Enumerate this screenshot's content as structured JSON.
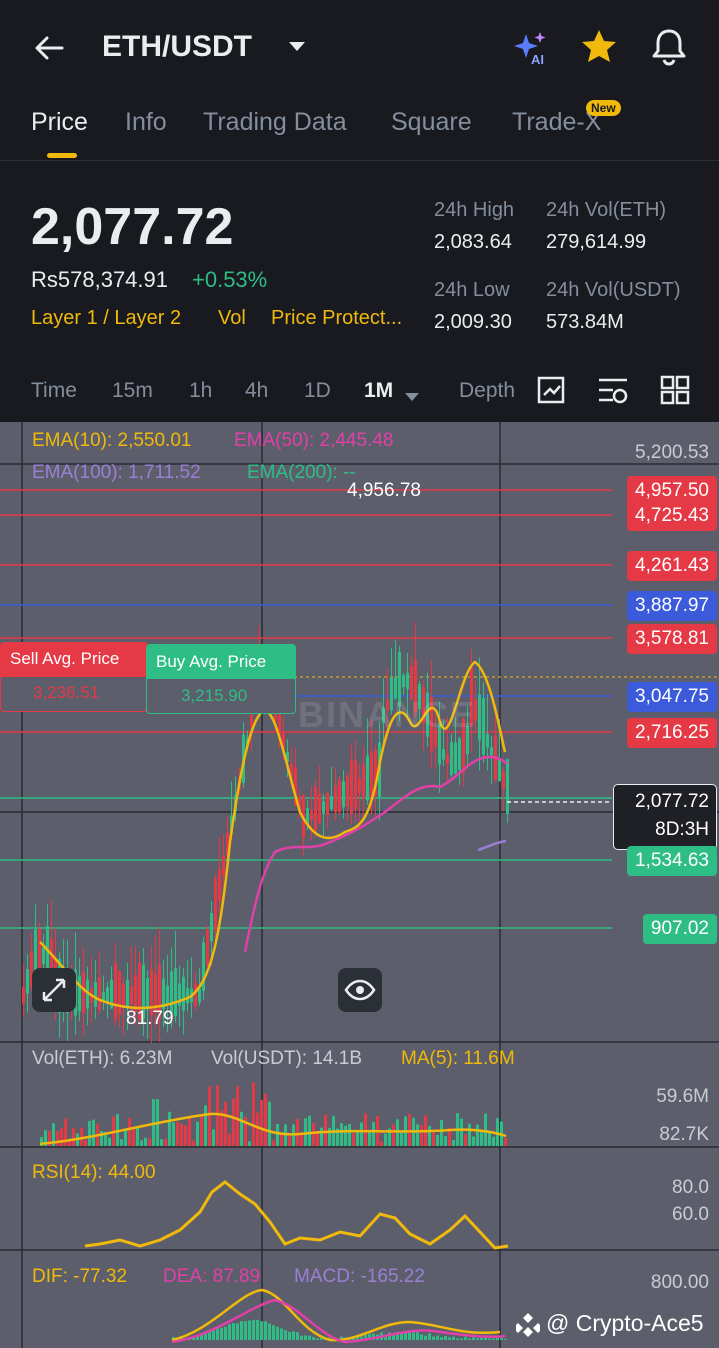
{
  "header": {
    "pair": "ETH/USDT",
    "ai_badge": "AI"
  },
  "tabs": [
    {
      "label": "Price",
      "active": true
    },
    {
      "label": "Info"
    },
    {
      "label": "Trading Data"
    },
    {
      "label": "Square"
    },
    {
      "label": "Trade-X",
      "badge": "New"
    }
  ],
  "ticker": {
    "last_price": "2,077.72",
    "fiat_price": "Rs578,374.91",
    "change": "+0.53%",
    "tags": [
      "Layer 1 / Layer 2",
      "Vol",
      "Price Protect..."
    ],
    "high_label": "24h High",
    "high": "2,083.64",
    "vol_eth_label": "24h Vol(ETH)",
    "vol_eth": "279,614.99",
    "low_label": "24h Low",
    "low": "2,009.30",
    "vol_usdt_label": "24h Vol(USDT)",
    "vol_usdt": "573.84M"
  },
  "intervals": {
    "items": [
      "Time",
      "15m",
      "1h",
      "4h",
      "1D",
      "1M",
      "Depth"
    ],
    "selected": "1M"
  },
  "chart": {
    "ema10": "EMA(10): 2,550.01",
    "ema50": "EMA(50): 2,445.48",
    "ema100": "EMA(100): 1,711.52",
    "ema200": "EMA(200): --",
    "axis_top": "5,200.53",
    "high_mark": "4,956.78",
    "low_mark": "81.79",
    "watermark": "BINANCE",
    "levels": [
      {
        "value": "4,957.50",
        "color": "#e63946"
      },
      {
        "value": "4,725.43",
        "color": "#e63946"
      },
      {
        "value": "4,261.43",
        "color": "#e63946"
      },
      {
        "value": "3,887.97",
        "color": "#3b5bdb"
      },
      {
        "value": "3,578.81",
        "color": "#e63946"
      },
      {
        "value": "3,047.75",
        "color": "#3b5bdb"
      },
      {
        "value": "2,716.25",
        "color": "#e63946"
      },
      {
        "value": "1,534.63",
        "color": "#2ebd85"
      },
      {
        "value": "907.02",
        "color": "#2ebd85"
      }
    ],
    "current_price": "2,077.72",
    "countdown": "8D:3H",
    "sell_avg_label": "Sell Avg. Price",
    "sell_avg_value": "3,236.51",
    "buy_avg_label": "Buy Avg. Price",
    "buy_avg_value": "3,215.90"
  },
  "volume": {
    "vol_eth": "Vol(ETH): 6.23M",
    "vol_usdt": "Vol(USDT): 14.1B",
    "ma5": "MA(5): 11.6M",
    "axis_top": "59.6M",
    "axis_bottom": "82.7K"
  },
  "rsi": {
    "label": "RSI(14): 44.00",
    "axis_80": "80.0",
    "axis_60": "60.0"
  },
  "macd": {
    "dif": "DIF: -77.32",
    "dea": "DEA: 87.89",
    "macd": "MACD: -165.22",
    "axis_top": "800.00"
  },
  "watermark_user": "@ Crypto-Ace5",
  "colors": {
    "up": "#2ebd85",
    "down": "#e63946",
    "accent": "#f0b90b"
  }
}
